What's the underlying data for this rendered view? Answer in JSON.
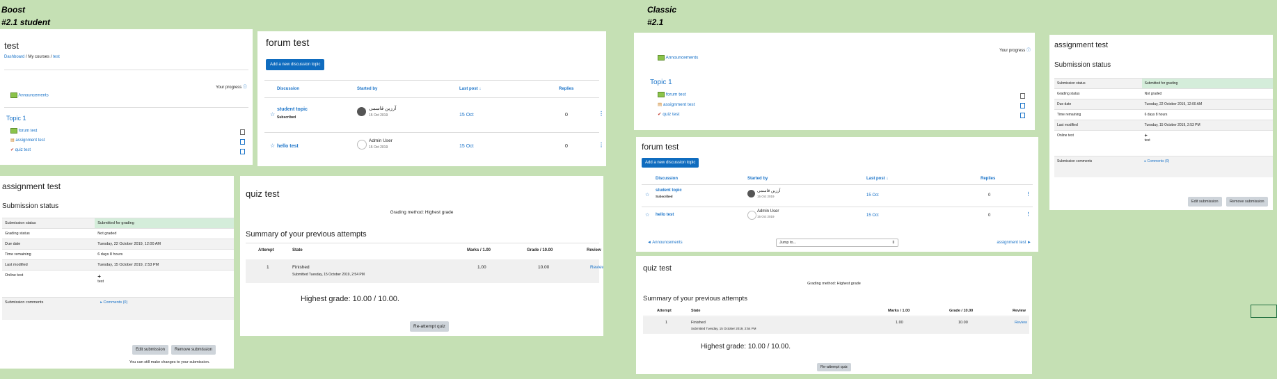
{
  "labels": {
    "boost_title": "Boost",
    "boost_sub": "#2.1 student",
    "classic_title": "Classic",
    "classic_sub": "#2.1"
  },
  "boost_course": {
    "title": "test",
    "breadcrumb": [
      "Dashboard",
      "My courses",
      "test"
    ],
    "progress_label": "Your progress",
    "announcements": "Announcements",
    "topic": "Topic 1",
    "activities": [
      "forum test",
      "assignment test",
      "quiz test"
    ]
  },
  "forum": {
    "title": "forum test",
    "add_button": "Add a new discussion topic",
    "columns": [
      "Discussion",
      "Started by",
      "Last post",
      "Replies"
    ],
    "rows": [
      {
        "topic": "student topic",
        "badge": "Subscribed",
        "author": "آرزین قاسمی",
        "date": "15 Oct 2019",
        "last": "15 Oct",
        "replies": "0"
      },
      {
        "topic": "hello test",
        "badge": "",
        "author": "Admin User",
        "date": "15 Oct 2019",
        "last": "15 Oct",
        "replies": "0"
      }
    ],
    "prev_link": "◄ Announcements",
    "jump": "Jump to...",
    "next_link": "assignment test ►"
  },
  "assignment": {
    "title": "assignment test",
    "subtitle": "Submission status",
    "rows": [
      {
        "label": "Submission status",
        "value": "Submitted for grading"
      },
      {
        "label": "Grading status",
        "value": "Not graded"
      },
      {
        "label": "Due date",
        "value": "Tuesday, 22 October 2019, 12:00 AM"
      },
      {
        "label": "Time remaining",
        "value": "6 days 8 hours"
      },
      {
        "label": "Last modified",
        "value": "Tuesday, 15 October 2019, 2:53 PM"
      },
      {
        "label": "Online text",
        "value": "test"
      },
      {
        "label": "Submission comments",
        "value": "Comments (0)"
      }
    ],
    "plus": "+",
    "edit_button": "Edit submission",
    "remove_button": "Remove submission",
    "note": "You can still make changes to your submission."
  },
  "quiz": {
    "title": "quiz test",
    "method": "Grading method: Highest grade",
    "summary": "Summary of your previous attempts",
    "columns": [
      "Attempt",
      "State",
      "Marks / 1.00",
      "Grade / 10.00",
      "Review"
    ],
    "row": {
      "attempt": "1",
      "state": "Finished",
      "submitted": "Submitted Tuesday, 15 October 2019, 2:54 PM",
      "marks": "1.00",
      "grade": "10.00",
      "review": "Review"
    },
    "highest": "Highest grade: 10.00 / 10.00.",
    "reattempt": "Re-attempt quiz"
  }
}
